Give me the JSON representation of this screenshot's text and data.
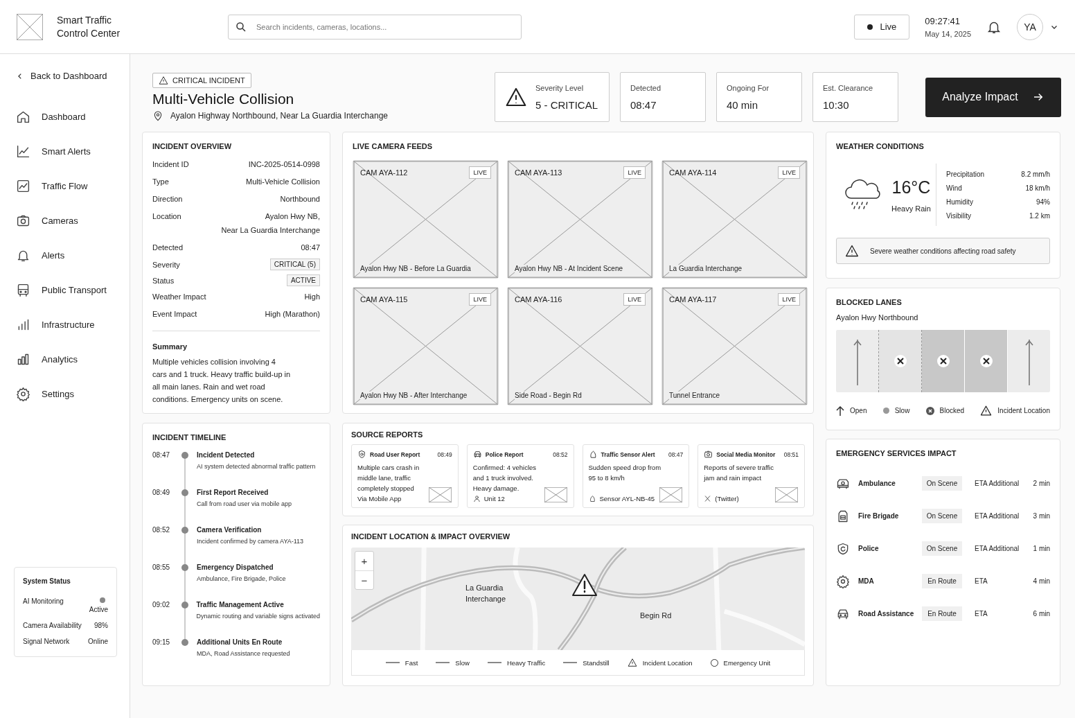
{
  "header": {
    "app_title": "Smart Traffic Control Center",
    "search": {
      "placeholder": "Search incidents, cameras, locations..."
    },
    "live_button": "Live",
    "time": "09:27:41",
    "date": "May 14, 2025",
    "avatar": "YA"
  },
  "sidebar": {
    "back_link": "Back to Dashboard",
    "items": [
      {
        "label": "Dashboard",
        "selected": false
      },
      {
        "label": "Smart Alerts",
        "selected": false
      },
      {
        "label": "Traffic Flow",
        "selected": false
      },
      {
        "label": "Cameras",
        "selected": false
      },
      {
        "label": "Alerts",
        "selected": false
      },
      {
        "label": "Public Transport",
        "selected": false
      },
      {
        "label": "Infrastructure",
        "selected": false
      },
      {
        "label": "Analytics",
        "selected": false
      },
      {
        "label": "Settings",
        "selected": false
      }
    ],
    "system_status": {
      "title": "System Status",
      "rows": [
        {
          "label": "AI Monitoring",
          "value": "Active",
          "kind": "dot"
        },
        {
          "label": "Camera Availability",
          "value": "98%",
          "kind": "text"
        },
        {
          "label": "Signal Network",
          "value": "Online",
          "kind": "text"
        }
      ]
    }
  },
  "incident": {
    "badge": "CRITICAL INCIDENT",
    "title": "Multi-Vehicle Collision",
    "location": "Ayalon Highway Northbound, Near La Guardia Interchange"
  },
  "stats": [
    {
      "label": "Severity Level",
      "value": "5 - CRITICAL",
      "kind": "warning"
    },
    {
      "label": "Detected",
      "value": "08:47",
      "kind": "plain"
    },
    {
      "label": "Ongoing For",
      "value": "40 min",
      "kind": "plain"
    },
    {
      "label": "Est. Clearance",
      "value": "10:30",
      "kind": "plain"
    }
  ],
  "analyze_button": "Analyze Impact",
  "overview": {
    "title": "INCIDENT OVERVIEW",
    "fields": [
      {
        "label": "Incident ID",
        "value": "INC-2025-0514-0998",
        "kind": "text"
      },
      {
        "label": "Type",
        "value": "Multi-Vehicle Collision",
        "kind": "text"
      },
      {
        "label": "Direction",
        "value": "Northbound",
        "kind": "text"
      },
      {
        "label": "Location",
        "value": "Ayalon Hwy NB,\nNear La Guardia Interchange",
        "kind": "text"
      },
      {
        "label": "Detected",
        "value": "08:47",
        "kind": "text"
      },
      {
        "label": "Severity",
        "value": "CRITICAL (5)",
        "kind": "tag"
      },
      {
        "label": "Status",
        "value": "ACTIVE",
        "kind": "tag"
      },
      {
        "label": "Weather Impact",
        "value": "High",
        "kind": "text"
      },
      {
        "label": "Event Impact",
        "value": "High (Marathon)",
        "kind": "text"
      }
    ],
    "summary_label": "Summary",
    "summary": "Multiple vehicles collision involving 4 cars and 1 truck. Heavy traffic build-up in all main lanes. Rain and wet road conditions. Emergency units on scene."
  },
  "timeline": {
    "title": "INCIDENT TIMELINE",
    "events": [
      {
        "time": "08:47",
        "title": "Incident Detected",
        "text": "AI system detected abnormal traffic pattern"
      },
      {
        "time": "08:49",
        "title": "First Report Received",
        "text": "Call from road user via mobile app"
      },
      {
        "time": "08:52",
        "title": "Camera Verification",
        "text": "Incident confirmed by camera AYA-113"
      },
      {
        "time": "08:55",
        "title": "Emergency Dispatched",
        "text": "Ambulance, Fire Brigade, Police"
      },
      {
        "time": "09:02",
        "title": "Traffic Management Active",
        "text": "Dynamic routing and variable signs activated"
      },
      {
        "time": "09:15",
        "title": "Additional Units En Route",
        "text": "MDA, Road Assistance requested"
      }
    ]
  },
  "cameras": {
    "title": "LIVE CAMERA FEEDS",
    "feeds": [
      {
        "name": "CAM AYA-112",
        "badge": "LIVE",
        "caption": "Ayalon Hwy NB - Before La Guardia"
      },
      {
        "name": "CAM AYA-113",
        "badge": "LIVE",
        "caption": "Ayalon Hwy NB - At Incident Scene"
      },
      {
        "name": "CAM AYA-114",
        "badge": "LIVE",
        "caption": "La Guardia Interchange"
      },
      {
        "name": "CAM AYA-115",
        "badge": "LIVE",
        "caption": "Ayalon Hwy NB - After Interchange"
      },
      {
        "name": "CAM AYA-116",
        "badge": "LIVE",
        "caption": "Side Road - Begin Rd"
      },
      {
        "name": "CAM AYA-117",
        "badge": "LIVE",
        "caption": "Tunnel Entrance"
      }
    ]
  },
  "source_reports": {
    "title": "SOURCE REPORTS",
    "reports": [
      {
        "title": "Road User Report",
        "time": "08:49",
        "text": "Multiple cars crash in middle lane, traffic completely stopped",
        "footer": "Via Mobile App"
      },
      {
        "title": "Police Report",
        "time": "08:52",
        "text": "Confirmed: 4 vehicles and 1 truck involved. Heavy damage.",
        "footer": "Unit 12"
      },
      {
        "title": "Traffic Sensor Alert",
        "time": "08:47",
        "text": "Sudden speed drop from 95 to 8 km/h",
        "footer": "Sensor AYL-NB-45"
      },
      {
        "title": "Social Media Monitor",
        "time": "08:51",
        "text": "Reports of severe traffic jam and rain impact",
        "footer": "(Twitter)"
      }
    ]
  },
  "map": {
    "title": "INCIDENT LOCATION & IMPACT OVERVIEW",
    "zoom_in": "+",
    "zoom_out": "−",
    "labels": [
      "La Guardia\nInterchange",
      "Begin Rd"
    ],
    "legend": [
      {
        "label": "Fast",
        "kind": "line"
      },
      {
        "label": "Slow",
        "kind": "line"
      },
      {
        "label": "Heavy Traffic",
        "kind": "line"
      },
      {
        "label": "Standstill",
        "kind": "line"
      },
      {
        "label": "Incident Location",
        "kind": "triangle"
      },
      {
        "label": "Emergency Unit",
        "kind": "circle"
      }
    ]
  },
  "weather": {
    "title": "WEATHER CONDITIONS",
    "temperature": "16°C",
    "condition": "Heavy Rain",
    "metrics": [
      {
        "label": "Precipitation",
        "value": "8.2 mm/h"
      },
      {
        "label": "Wind",
        "value": "18 km/h"
      },
      {
        "label": "Humidity",
        "value": "94%"
      },
      {
        "label": "Visibility",
        "value": "1.2 km"
      }
    ],
    "alert": "Severe weather conditions affecting road safety"
  },
  "blocked_lanes": {
    "title": "BLOCKED LANES",
    "road": "Ayalon Hwy Northbound",
    "lanes": [
      {
        "kind": "open"
      },
      {
        "kind": "blocked"
      },
      {
        "kind": "closed"
      },
      {
        "kind": "closed"
      },
      {
        "kind": "open"
      }
    ],
    "legend": [
      {
        "label": "Open",
        "kind": "arrow"
      },
      {
        "label": "Slow",
        "kind": "dot"
      },
      {
        "label": "Blocked",
        "kind": "x"
      },
      {
        "label": "Incident Location",
        "kind": "triangle"
      }
    ]
  },
  "emergency": {
    "title": "EMERGENCY SERVICES IMPACT",
    "services": [
      {
        "name": "Ambulance",
        "status": "On Scene",
        "eta_label": "ETA Additional",
        "eta": "2 min"
      },
      {
        "name": "Fire Brigade",
        "status": "On Scene",
        "eta_label": "ETA Additional",
        "eta": "3 min"
      },
      {
        "name": "Police",
        "status": "On Scene",
        "eta_label": "ETA Additional",
        "eta": "1 min"
      },
      {
        "name": "MDA",
        "status": "En Route",
        "eta_label": "ETA",
        "eta": "4 min"
      },
      {
        "name": "Road Assistance",
        "status": "En Route",
        "eta_label": "ETA",
        "eta": "6 min"
      }
    ]
  }
}
